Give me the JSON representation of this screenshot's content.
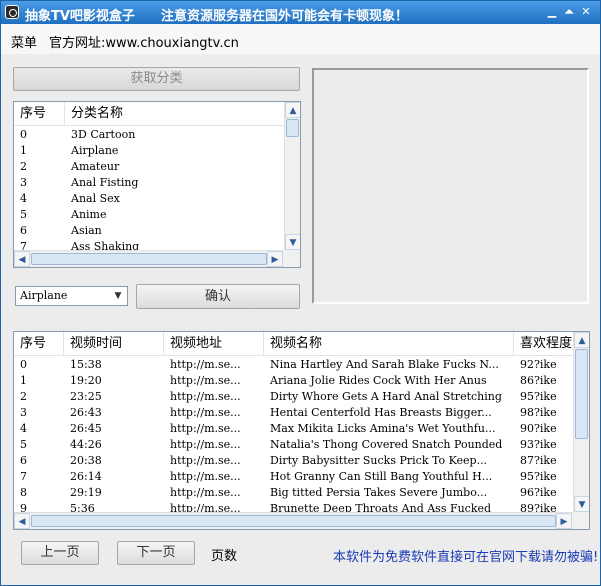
{
  "titlebar": {
    "title": "抽象TV吧影视盒子",
    "notice": "注意资源服务器在国外可能会有卡顿现象！",
    "min_icon": "minimize-icon",
    "max_icon": "maximize-icon",
    "close_icon": "close-icon"
  },
  "menubar": {
    "menu_label": "菜单",
    "website_label": "官方网址:www.chouxiangtv.cn"
  },
  "category_panel": {
    "fetch_button": "获取分类",
    "columns": [
      "序号",
      "分类名称"
    ],
    "rows": [
      [
        "0",
        "3D Cartoon"
      ],
      [
        "1",
        "Airplane"
      ],
      [
        "2",
        "Amateur"
      ],
      [
        "3",
        "Anal Fisting"
      ],
      [
        "4",
        "Anal Sex"
      ],
      [
        "5",
        "Anime"
      ],
      [
        "6",
        "Asian"
      ],
      [
        "7",
        "Ass Shaking"
      ]
    ],
    "selected_category": "Airplane",
    "confirm_button": "确认"
  },
  "video_panel": {
    "columns": [
      "序号",
      "视频时间",
      "视频地址",
      "视频名称",
      "喜欢程度"
    ],
    "rows": [
      [
        "0",
        "15:38",
        "http://m.se...",
        "Nina Hartley And Sarah Blake Fucks N...",
        "92?ike"
      ],
      [
        "1",
        "19:20",
        "http://m.se...",
        "Ariana Jolie Rides Cock With Her Anus",
        "86?ike"
      ],
      [
        "2",
        "23:25",
        "http://m.se...",
        "Dirty Whore Gets A Hard Anal Stretching",
        "95?ike"
      ],
      [
        "3",
        "26:43",
        "http://m.se...",
        "Hentai Centerfold Has Breasts Bigger...",
        "98?ike"
      ],
      [
        "4",
        "26:45",
        "http://m.se...",
        "Max Mikita Licks Amina's Wet Youthfu...",
        "90?ike"
      ],
      [
        "5",
        "44:26",
        "http://m.se...",
        "Natalia's Thong Covered Snatch Pounded",
        "93?ike"
      ],
      [
        "6",
        "20:38",
        "http://m.se...",
        "Dirty Babysitter Sucks Prick To Keep...",
        "87?ike"
      ],
      [
        "7",
        "26:14",
        "http://m.se...",
        "Hot Granny Can Still Bang Youthful H...",
        "95?ike"
      ],
      [
        "8",
        "29:19",
        "http://m.se...",
        "Big titted Persia Takes Severe Jumbo...",
        "96?ike"
      ],
      [
        "9",
        "5:36",
        "http://m.se...",
        "Brunette Deep Throats And Ass Fucked",
        "89?ike"
      ]
    ]
  },
  "footer": {
    "prev_button": "上一页",
    "next_button": "下一页",
    "page_label": "页数",
    "notice": "本软件为免费软件直接可在官网下载请勿被骗!",
    "notice_color": "#1a3bb5"
  }
}
